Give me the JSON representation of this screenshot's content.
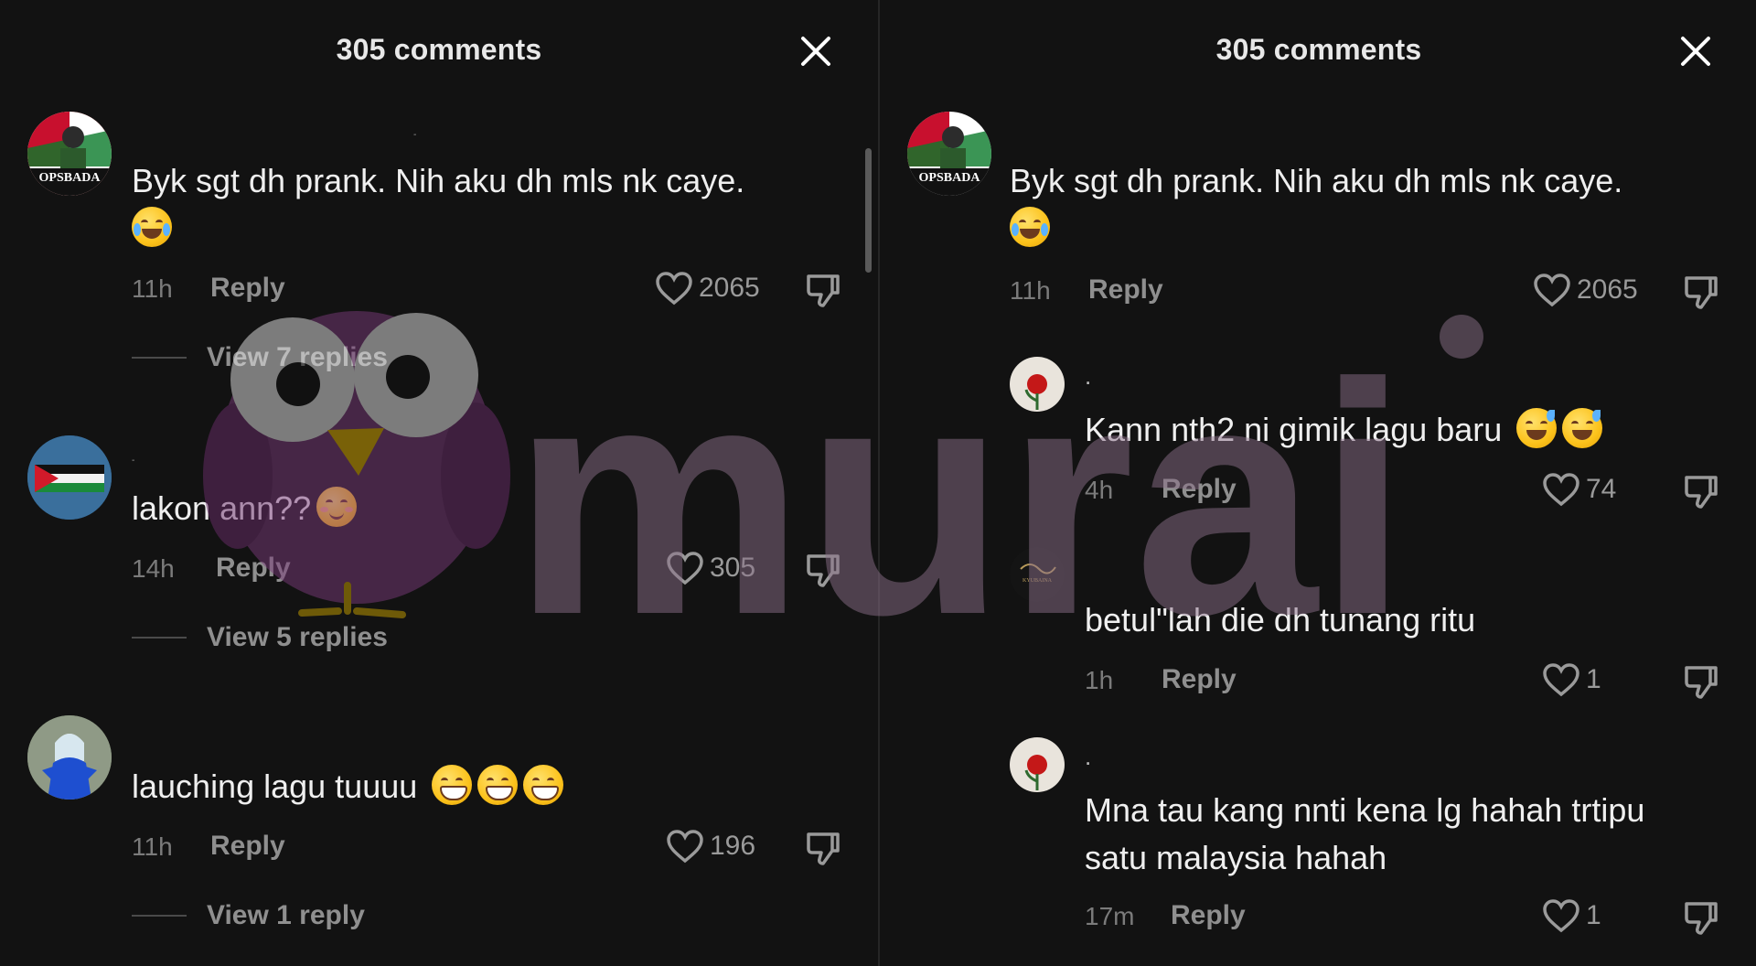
{
  "left_panel": {
    "title": "305 comments",
    "comments": [
      {
        "username": "-",
        "avatar_text": "OPSBADA",
        "text": "Byk sgt dh prank. Nih aku dh mls nk caye.",
        "emoji": "laughing-tears",
        "time": "11h",
        "reply_label": "Reply",
        "likes": "2065",
        "view_replies": "View 7 replies"
      },
      {
        "username": "-",
        "avatar_text": "",
        "text": "lakon ann??",
        "emoji": "relieved",
        "time": "14h",
        "reply_label": "Reply",
        "likes": "305",
        "view_replies": "View 5 replies"
      },
      {
        "username": "",
        "avatar_text": "",
        "text": "lauching lagu tuuuu",
        "emoji": "grinning x3",
        "time": "11h",
        "reply_label": "Reply",
        "likes": "196",
        "view_replies": "View 1 reply"
      }
    ]
  },
  "right_panel": {
    "title": "305 comments",
    "comments": [
      {
        "username": "",
        "avatar_text": "OPSBADA",
        "text": "Byk sgt dh prank. Nih aku dh mls nk caye.",
        "emoji": "laughing-tears",
        "time": "11h",
        "reply_label": "Reply",
        "likes": "2065"
      }
    ],
    "replies": [
      {
        "username": ".",
        "text": "Kann nth2 ni gimik lagu baru",
        "emoji": "sweat-smile x2",
        "time": "4h",
        "reply_label": "Reply",
        "likes": "74"
      },
      {
        "username": "",
        "avatar_text": "KYUBAINA",
        "text": "betul\"lah die dh tunang ritu",
        "time": "1h",
        "reply_label": "Reply",
        "likes": "1"
      },
      {
        "username": ".",
        "text_line1": "Mna tau kang nnti kena lg hahah trtipu",
        "text_line2": "satu malaysia hahah",
        "time": "17m",
        "reply_label": "Reply",
        "likes": "1"
      }
    ]
  },
  "watermark": {
    "text": "murai",
    "color": "#8a6f88",
    "bird_color": "#7a3a7a"
  },
  "icons": [
    "close-icon",
    "heart-icon",
    "dislike-icon"
  ],
  "colors": {
    "background": "#121212",
    "text": "#efefef",
    "muted": "#8f8f8f"
  }
}
